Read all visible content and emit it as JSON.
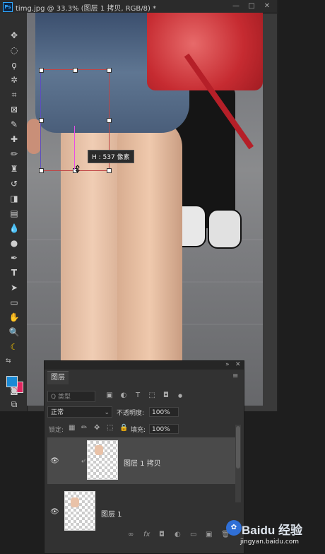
{
  "window": {
    "app_icon": "Ps",
    "title": "timg.jpg @ 33.3% (图层 1 拷贝, RGB/8) *",
    "controls": [
      "—",
      "□",
      "✕"
    ]
  },
  "toolbar": {
    "tools": [
      {
        "icon": "move-tool-icon",
        "glyph": "✥"
      },
      {
        "icon": "ellipse-marquee-icon",
        "glyph": "◌"
      },
      {
        "icon": "lasso-icon",
        "glyph": "ϙ"
      },
      {
        "icon": "magic-wand-icon",
        "glyph": "✲"
      },
      {
        "icon": "crop-icon",
        "glyph": "⌗"
      },
      {
        "icon": "frame-icon",
        "glyph": "⊠"
      },
      {
        "icon": "eyedropper-icon",
        "glyph": "✎"
      },
      {
        "icon": "healing-brush-icon",
        "glyph": "✚"
      },
      {
        "icon": "brush-icon",
        "glyph": "✏"
      },
      {
        "icon": "clone-stamp-icon",
        "glyph": "♜"
      },
      {
        "icon": "history-brush-icon",
        "glyph": "↺"
      },
      {
        "icon": "eraser-icon",
        "glyph": "◨"
      },
      {
        "icon": "gradient-icon",
        "glyph": "▤"
      },
      {
        "icon": "blur-icon",
        "glyph": "💧"
      },
      {
        "icon": "dodge-icon",
        "glyph": "●"
      },
      {
        "icon": "pen-icon",
        "glyph": "✒"
      },
      {
        "icon": "type-icon",
        "glyph": "T"
      },
      {
        "icon": "path-selection-icon",
        "glyph": "➤"
      },
      {
        "icon": "shape-icon",
        "glyph": "▭"
      },
      {
        "icon": "hand-icon",
        "glyph": "✋"
      },
      {
        "icon": "zoom-icon",
        "glyph": "🔍"
      },
      {
        "icon": "banana-icon",
        "glyph": "☾"
      }
    ],
    "foreground_color": "#1a8ad6",
    "background_color": "#e0245e",
    "quickmask_glyph": "◙",
    "screenmode_glyph": "⧉"
  },
  "canvas": {
    "tooltip": "H : 537 像素"
  },
  "layers_panel": {
    "collapse_glyph": "»",
    "close_glyph": "✕",
    "tab_label": "图层",
    "menu_glyph": "≡",
    "filter_placeholder": "Q 类型",
    "filter_icons": [
      "▣",
      "◐",
      "T",
      "⬚",
      "◘",
      "●"
    ],
    "blend_mode": "正常",
    "opacity_label": "不透明度:",
    "opacity_value": "100%",
    "lock_label": "锁定:",
    "lock_icons": [
      "▦",
      "✏",
      "✥",
      "⬚",
      "🔒"
    ],
    "fill_label": "填充:",
    "fill_value": "100%",
    "layers": [
      {
        "name": "图层 1 拷贝",
        "visible_glyph": "👁",
        "link_glyph": "⤶",
        "selected": true
      },
      {
        "name": "图层 1",
        "visible_glyph": "👁",
        "selected": false
      }
    ],
    "footer_icons": [
      "∞",
      "fx",
      "◘",
      "◐",
      "▭",
      "▣",
      "🗑"
    ]
  },
  "watermark": {
    "logo": "Baidu 经验",
    "url": "jingyan.baidu.com",
    "paw_glyph": "✿"
  }
}
